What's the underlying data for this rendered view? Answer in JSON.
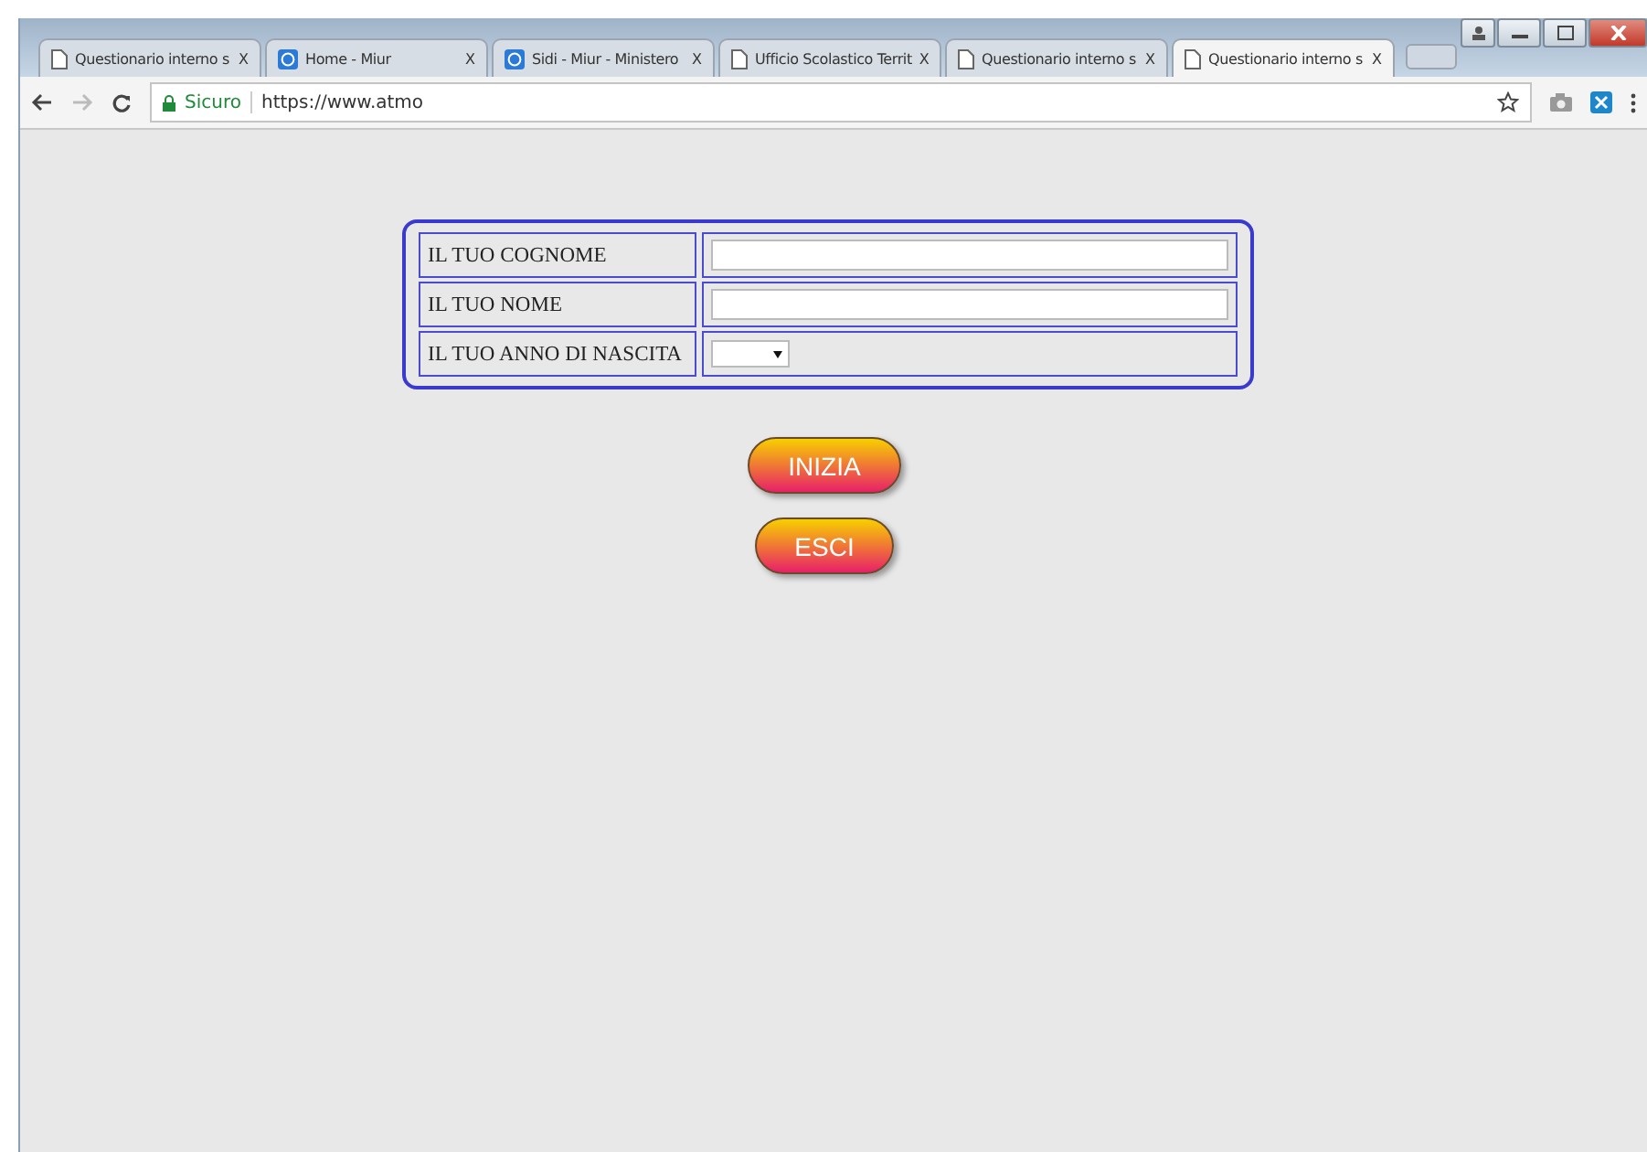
{
  "tabs": [
    {
      "title": "Questionario interno s",
      "kind": "page",
      "close": "X",
      "selected": false
    },
    {
      "title": "Home - Miur",
      "kind": "site",
      "close": "X",
      "selected": false
    },
    {
      "title": "Sidi - Miur - Ministero",
      "kind": "site",
      "close": "X",
      "selected": false
    },
    {
      "title": "Ufficio Scolastico Territ",
      "kind": "page",
      "close": "X",
      "selected": false
    },
    {
      "title": "Questionario interno s",
      "kind": "page",
      "close": "X",
      "selected": false
    },
    {
      "title": "Questionario interno s",
      "kind": "page",
      "close": "X",
      "selected": true
    }
  ],
  "address": {
    "security": "Sicuro",
    "url": "https://www.atmo"
  },
  "form": {
    "rows": [
      {
        "label": "IL TUO COGNOME",
        "kind": "text"
      },
      {
        "label": "IL TUO NOME",
        "kind": "text"
      },
      {
        "label": "IL TUO ANNO DI NASCITA",
        "kind": "select"
      }
    ]
  },
  "buttons": [
    "INIZIA",
    "ESCI"
  ]
}
